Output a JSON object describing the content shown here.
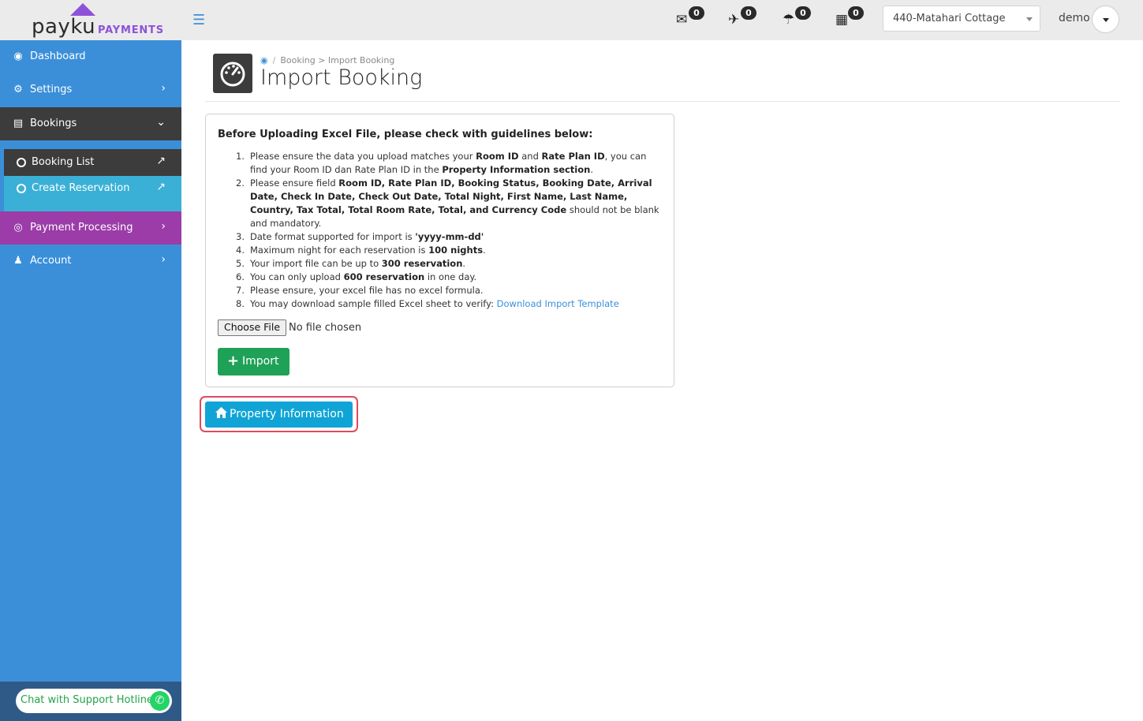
{
  "brand": {
    "name": "payku",
    "sub": "PAYMENTS"
  },
  "header": {
    "notifications": [
      {
        "icon": "envelope-open-icon",
        "count": "0"
      },
      {
        "icon": "check-in-person-icon",
        "count": "0"
      },
      {
        "icon": "check-out-person-icon",
        "count": "0"
      },
      {
        "icon": "calendar-icon",
        "count": "0"
      }
    ],
    "property_selected": "440-Matahari Cottage",
    "user": "demo"
  },
  "sidebar": {
    "items": [
      {
        "label": "Dashboard"
      },
      {
        "label": "Settings"
      },
      {
        "label": "Bookings"
      },
      {
        "label": "Payment Processing"
      },
      {
        "label": "Account"
      }
    ],
    "sub_items": [
      {
        "label": "Booking List"
      },
      {
        "label": "Create Reservation"
      }
    ],
    "chat_label": "Chat with Support Hotline"
  },
  "page": {
    "breadcrumb": "Booking > Import Booking",
    "title": "Import Booking"
  },
  "card": {
    "title": "Before Uploading Excel File, please check with guidelines below:",
    "g1": {
      "a": "Please ensure the data you upload matches your ",
      "b1": "Room ID",
      "c": " and ",
      "b2": "Rate Plan ID",
      "d": ", you can find your Room ID dan Rate Plan ID in the ",
      "b3": "Property Information section",
      "e": "."
    },
    "g2": {
      "a": "Please ensure field ",
      "b": "Room ID, Rate Plan ID, Booking Status, Booking Date, Arrival Date, Check In Date, Check Out Date, Total Night, First Name, Last Name, Country, Tax Total, Total Room Rate, Total, and Currency Code",
      "c": " should not be blank and mandatory."
    },
    "g3": {
      "a": "Date format supported for import is ",
      "b": "'yyyy-mm-dd'"
    },
    "g4": {
      "a": "Maximum night for each reservation is ",
      "b": "100 nights",
      "c": "."
    },
    "g5": {
      "a": "Your import file can be up to ",
      "b": "300 reservation",
      "c": "."
    },
    "g6": {
      "a": "You can only upload ",
      "b": "600 reservation",
      "c": " in one day."
    },
    "g7": {
      "a": "Please ensure, your excel file has no excel formula."
    },
    "g8": {
      "a": "You may download sample filled Excel sheet to verify: ",
      "link": "Download Import Template"
    },
    "file_button": "Choose File",
    "file_status": "No file chosen",
    "import_label": "Import"
  },
  "property_info_label": "Property Information",
  "colors": {
    "sidebar": "#3b8fd9",
    "active": "#3c3c3c",
    "payment": "#9b3ca8",
    "import_green": "#1fa157",
    "property_blue": "#10a4d6",
    "highlight_red": "#e04a5a"
  }
}
